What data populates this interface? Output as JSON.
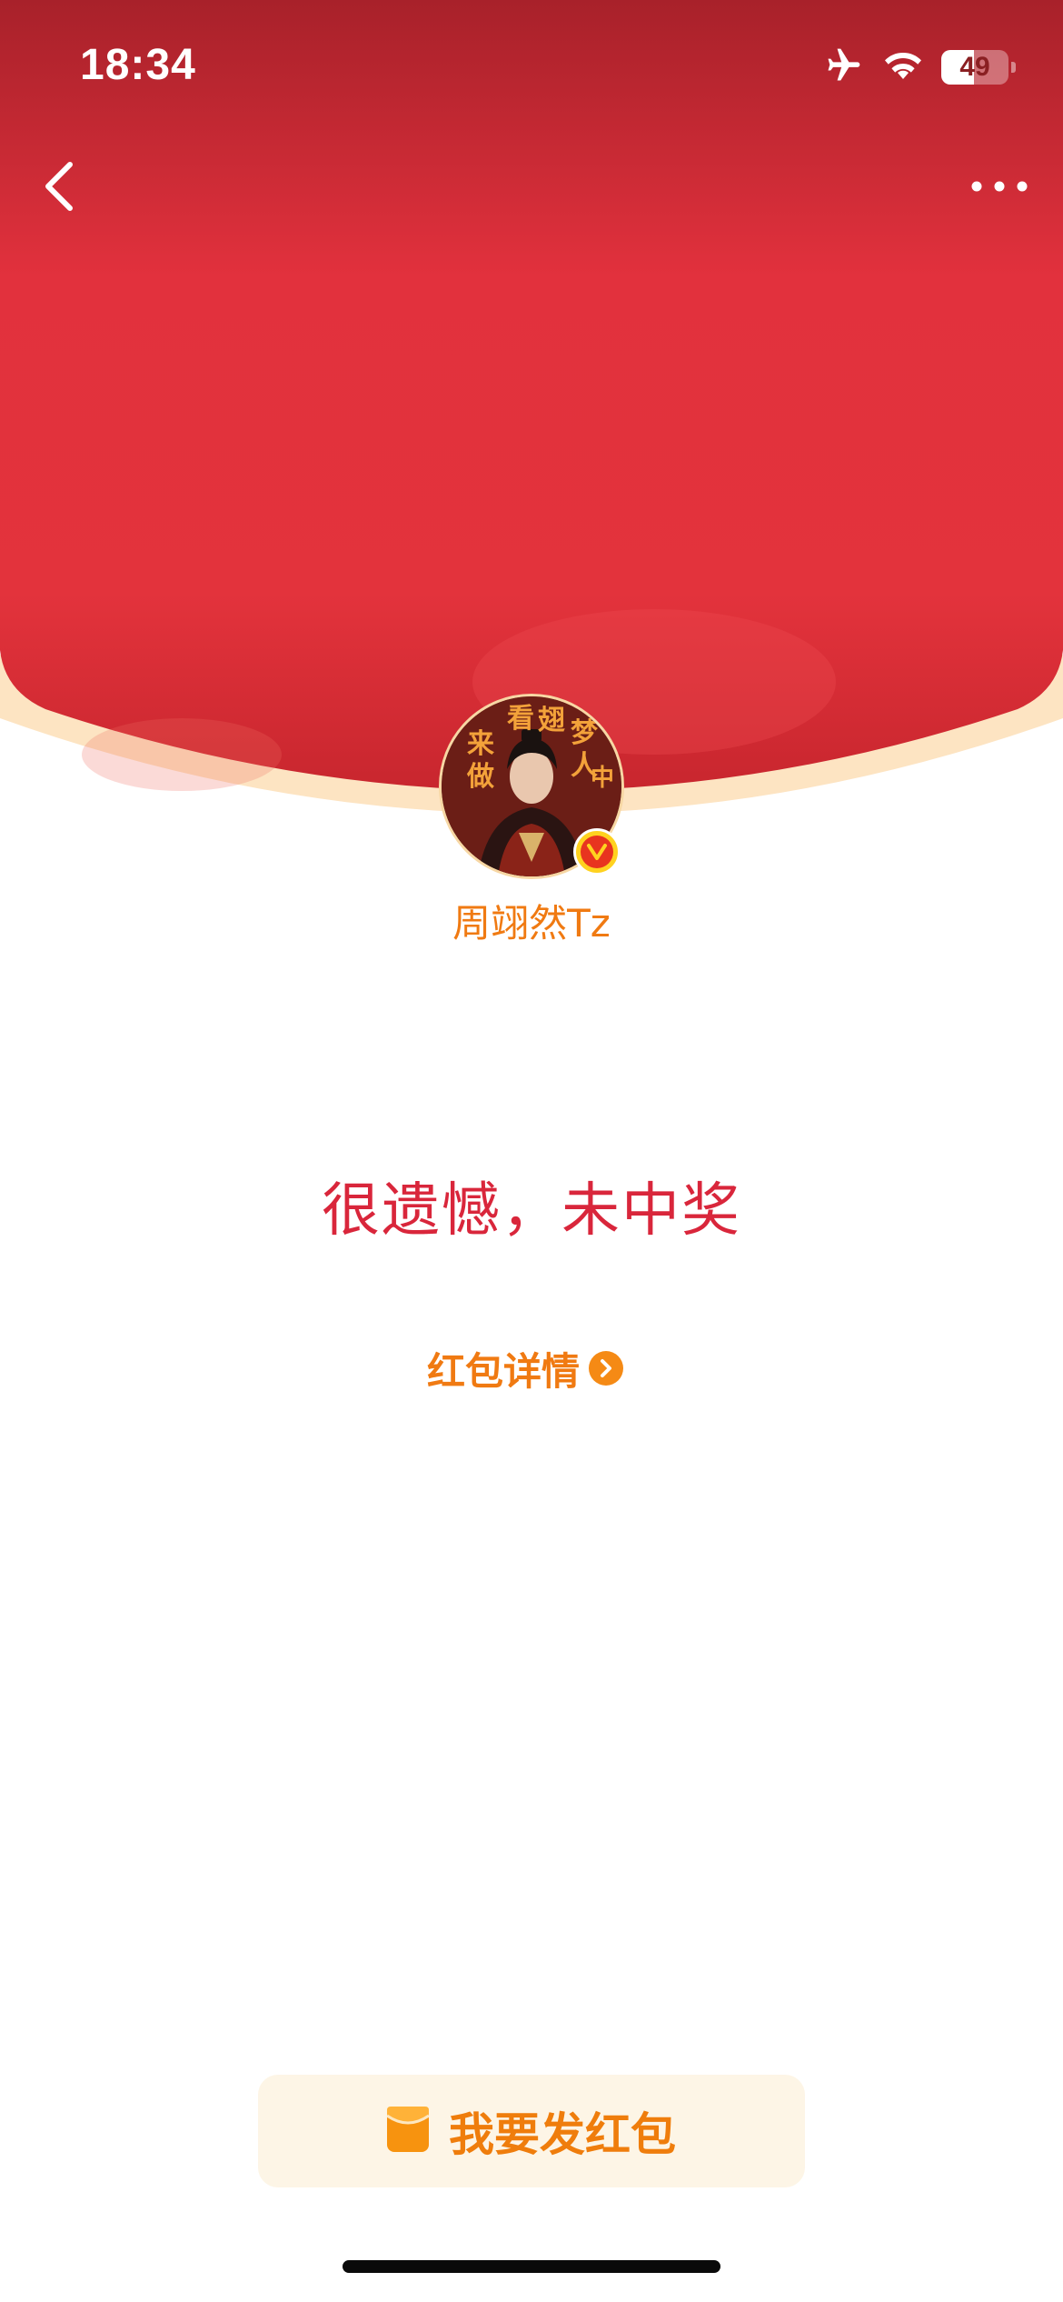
{
  "status_bar": {
    "time": "18:34",
    "battery_level": "49",
    "battery_fraction": 0.49,
    "icons": [
      "airplane-icon",
      "wifi-icon",
      "battery-icon"
    ]
  },
  "nav": {
    "back_icon": "chevron-left-icon",
    "more_icon": "more-dots-icon"
  },
  "sender": {
    "name": "周翊然Tz",
    "avatar_text": [
      "来",
      "看",
      "翅",
      "梦",
      "做",
      "人",
      "中"
    ],
    "verified_badge": "V"
  },
  "result": {
    "message": "很遗憾，未中奖"
  },
  "details": {
    "label": "红包详情"
  },
  "send_button": {
    "label": "我要发红包"
  },
  "colors": {
    "hero_red": "#e3323c",
    "accent_orange": "#f07a12",
    "result_red": "#d9263b",
    "button_bg": "#fdf5e6"
  }
}
